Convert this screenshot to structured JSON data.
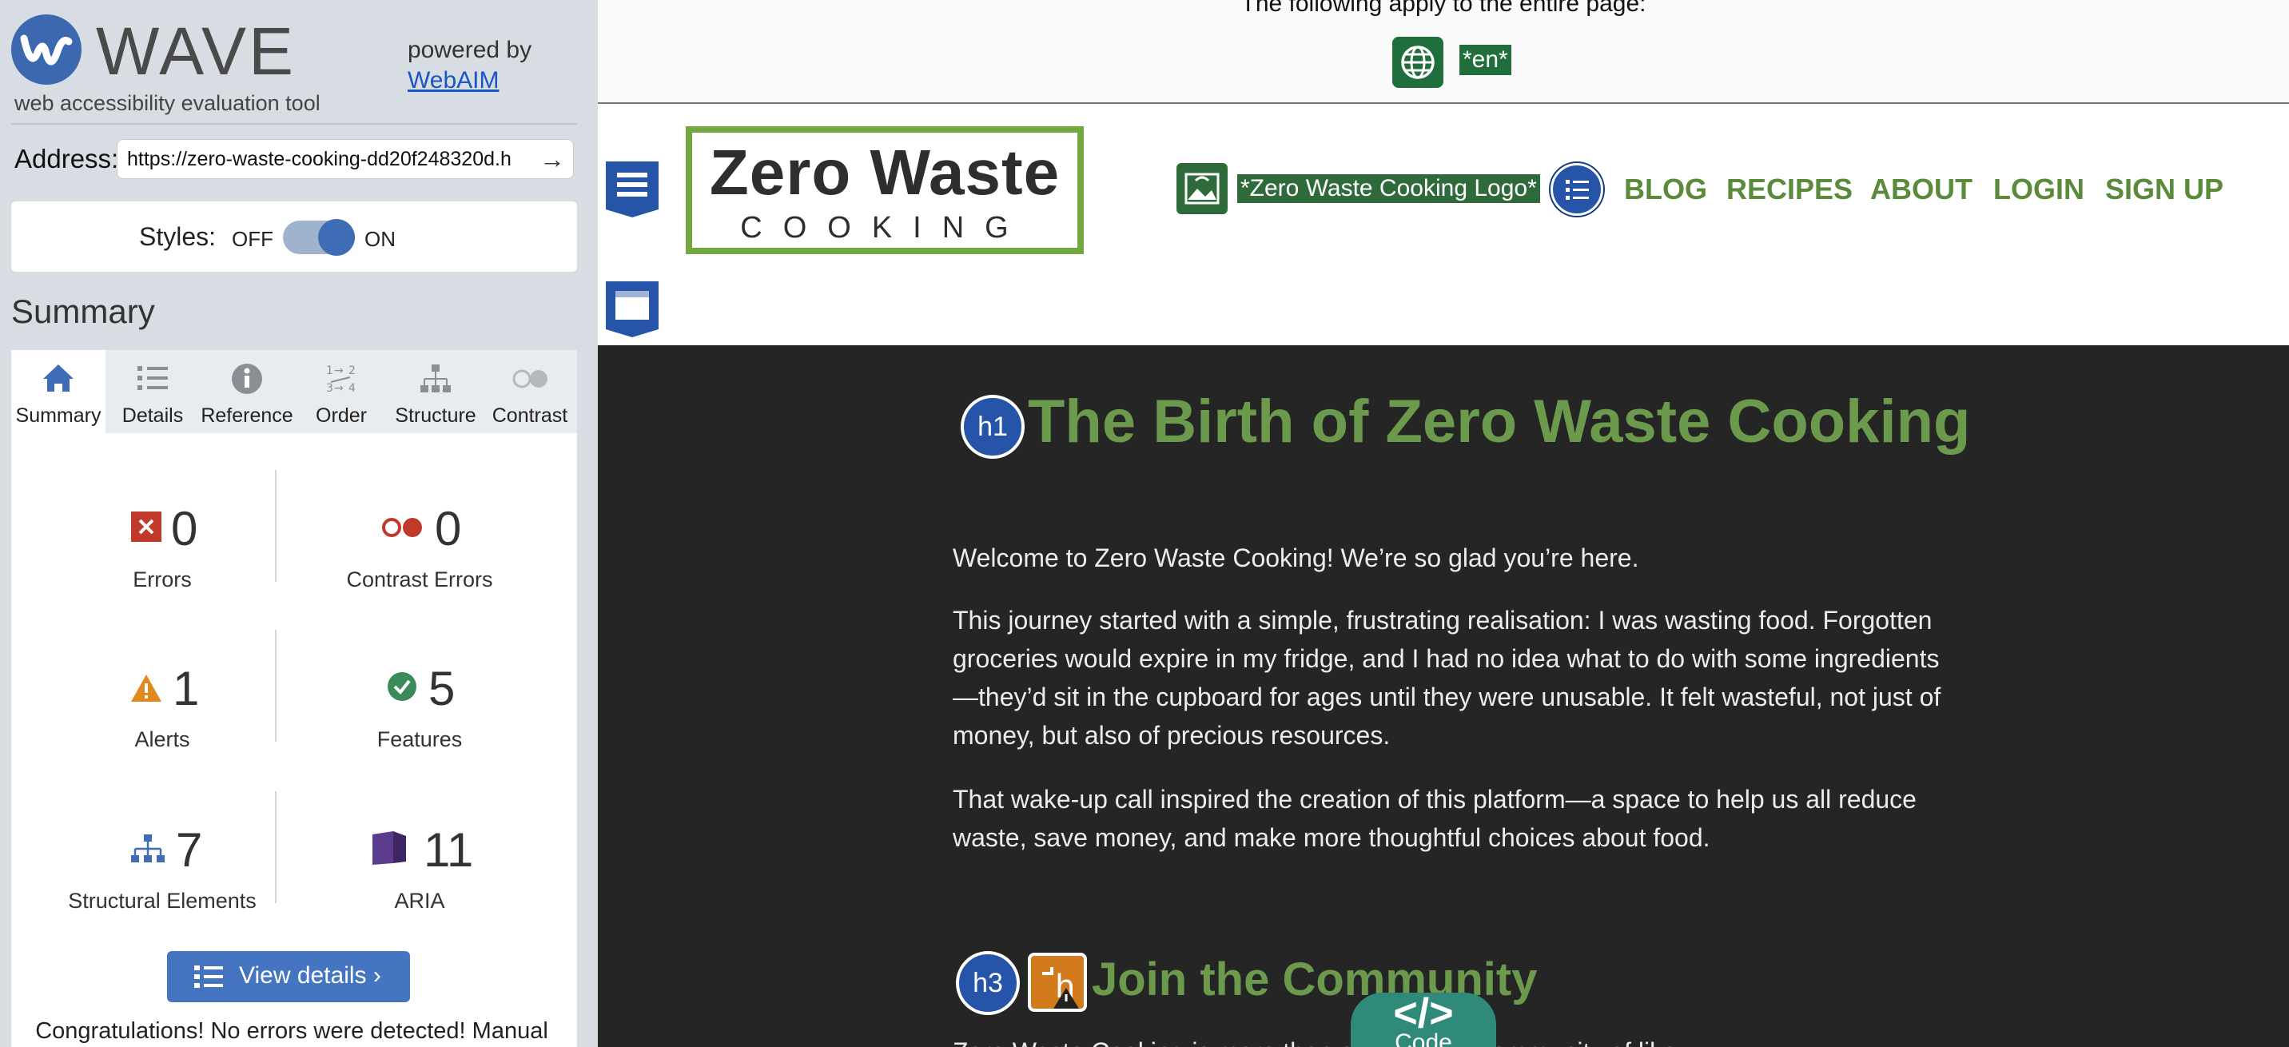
{
  "wave": {
    "title": "WAVE",
    "subtitle": "web accessibility evaluation tool",
    "powered_by": "powered by",
    "powered_link": "WebAIM",
    "address_label": "Address:",
    "address_value": "https://zero-waste-cooking-dd20f248320d.h",
    "styles_label": "Styles:",
    "styles_off": "OFF",
    "styles_on": "ON",
    "styles_state": "on",
    "summary_heading": "Summary",
    "tabs": [
      {
        "label": "Summary",
        "icon": "home-icon",
        "active": true
      },
      {
        "label": "Details",
        "icon": "list-icon",
        "active": false
      },
      {
        "label": "Reference",
        "icon": "info-icon",
        "active": false
      },
      {
        "label": "Order",
        "icon": "order-icon",
        "active": false
      },
      {
        "label": "Structure",
        "icon": "structure-icon",
        "active": false
      },
      {
        "label": "Contrast",
        "icon": "contrast-icon",
        "active": false
      }
    ],
    "stats": {
      "errors": {
        "value": "0",
        "label": "Errors"
      },
      "contrast_errors": {
        "value": "0",
        "label": "Contrast Errors"
      },
      "alerts": {
        "value": "1",
        "label": "Alerts"
      },
      "features": {
        "value": "5",
        "label": "Features"
      },
      "structural": {
        "value": "7",
        "label": "Structural Elements"
      },
      "aria": {
        "value": "11",
        "label": "ARIA"
      }
    },
    "view_details": "View details ›",
    "congrats": "Congratulations! No errors were detected! Manual"
  },
  "page": {
    "apply_text": "The following apply to the entire page:",
    "lang_tag": "*en*",
    "logo_line1": "Zero Waste",
    "logo_line2": "COOKING",
    "logo_alt": "*Zero Waste Cooking Logo*",
    "nav": [
      "BLOG",
      "RECIPES",
      "ABOUT",
      "LOGIN",
      "SIGN UP"
    ],
    "h1_badge": "h1",
    "h1": "The Birth of Zero Waste Cooking",
    "paragraphs": [
      "Welcome to Zero Waste Cooking! We’re so glad you’re here.",
      "This journey started with a simple, frustrating realisation: I was wasting food. Forgotten groceries would expire in my fridge, and I had no idea what to do with some ingredients—they’d sit in the cupboard for ages until they were unusable. It felt wasteful, not just of money, but also of precious resources.",
      "That wake-up call inspired the creation of this platform—a space to help us all reduce waste, save money, and make more thoughtful choices about food."
    ],
    "h3_badge": "h3",
    "h3": "Join the Community",
    "cut_paragraph": "Zero Waste Cooking is more than a                  a growing community of like",
    "code_symbol": "</>",
    "code_label": "Code"
  },
  "colors": {
    "wave_blue": "#3c68b0",
    "brand_green": "#6c9a4c",
    "dark_bg": "#252525",
    "error_red": "#c0392b",
    "alert_orange": "#e08a1e",
    "feature_green": "#3a8a5a",
    "aria_purple": "#5b3c8f"
  }
}
